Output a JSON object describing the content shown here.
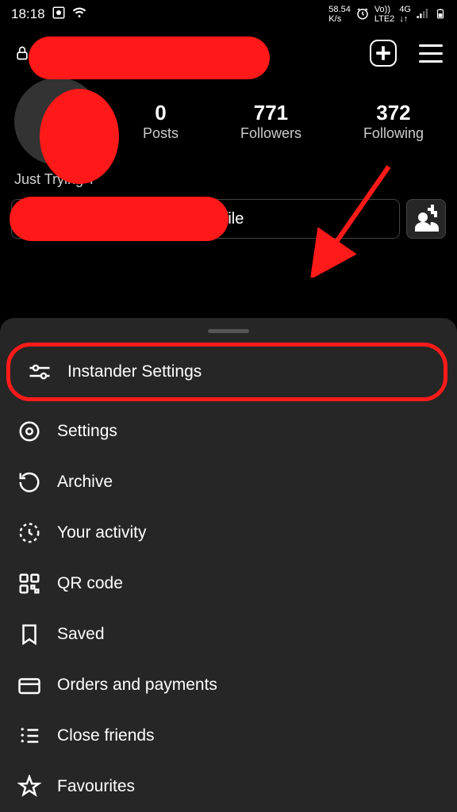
{
  "status": {
    "time": "18:18",
    "speed": "58.54",
    "speed_unit": "K/s",
    "network": "4G",
    "lte": "LTE2"
  },
  "profile": {
    "posts_count": "0",
    "posts_label": "Posts",
    "followers_count": "771",
    "followers_label": "Followers",
    "following_count": "372",
    "following_label": "Following",
    "bio_visible": "Just Trying T",
    "edit_label": "Edit Profile"
  },
  "menu": {
    "items": [
      {
        "label": "Instander Settings"
      },
      {
        "label": "Settings"
      },
      {
        "label": "Archive"
      },
      {
        "label": "Your activity"
      },
      {
        "label": "QR code"
      },
      {
        "label": "Saved"
      },
      {
        "label": "Orders and payments"
      },
      {
        "label": "Close friends"
      },
      {
        "label": "Favourites"
      }
    ]
  }
}
